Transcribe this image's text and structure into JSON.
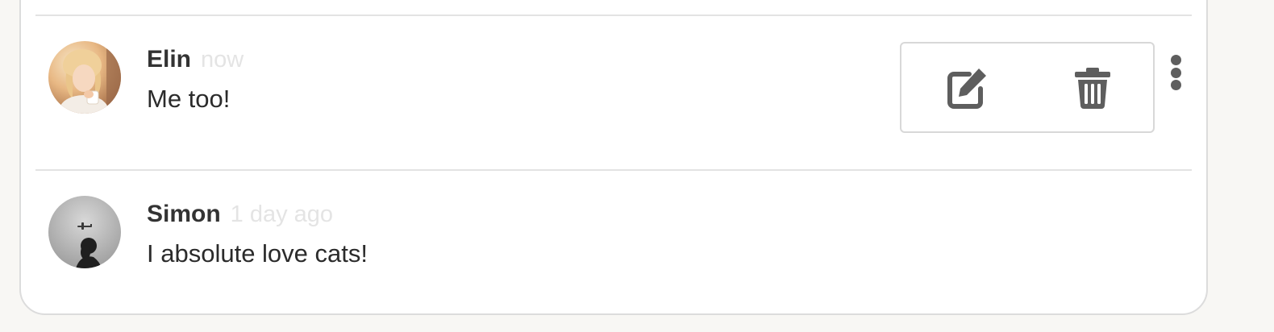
{
  "comments": [
    {
      "author": "Elin",
      "time": "now",
      "text": "Me too!",
      "avatar": "woman-portrait-avatar",
      "actions": {
        "edit_icon": "edit-icon",
        "delete_icon": "trash-icon",
        "more_icon": "vertical-dots-icon"
      }
    },
    {
      "author": "Simon",
      "time": "1 day ago",
      "text": "I absolute love cats!",
      "avatar": "airplane-silhouette-avatar"
    }
  ],
  "colors": {
    "author": "#333333",
    "time": "#e4e4e4",
    "icon": "#5e5e5e",
    "border": "#dcdcdc",
    "background": "#f8f7f4"
  }
}
